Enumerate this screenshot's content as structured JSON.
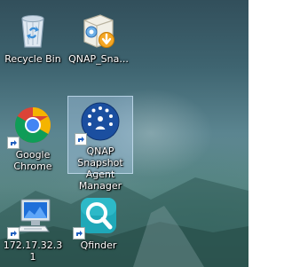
{
  "desktop": {
    "icons": [
      {
        "label": "Recycle Bin",
        "icon": "recycle-bin-icon"
      },
      {
        "label": "QNAP_Sna...",
        "icon": "installer-package-icon"
      },
      {
        "label": "Google Chrome",
        "icon": "chrome-icon"
      },
      {
        "label": "QNAP Snapshot Agent Manager",
        "icon": "qnap-snapshot-agent-icon"
      },
      {
        "label": "172.17.32.31",
        "icon": "remote-desktop-icon"
      },
      {
        "label": "Qfinder",
        "icon": "qfinder-icon"
      }
    ]
  },
  "colors": {
    "selection": "#aac8e6",
    "qnap_blue": "#1b4fa0",
    "qfinder_teal": "#1fa8b8"
  }
}
